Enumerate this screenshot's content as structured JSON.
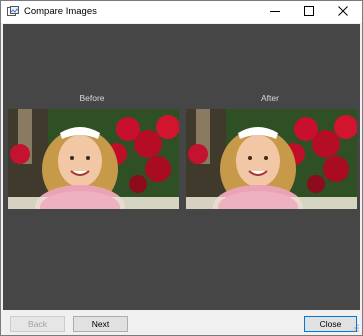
{
  "window": {
    "title": "Compare Images",
    "icons": {
      "app": "compare-images-app-icon",
      "minimize": "minimize-icon",
      "maximize": "maximize-icon",
      "close": "close-icon"
    }
  },
  "comparison": {
    "before_label": "Before",
    "after_label": "After",
    "background_color": "#464646"
  },
  "footer": {
    "back_label": "Back",
    "next_label": "Next",
    "close_label": "Close",
    "back_enabled": false
  }
}
